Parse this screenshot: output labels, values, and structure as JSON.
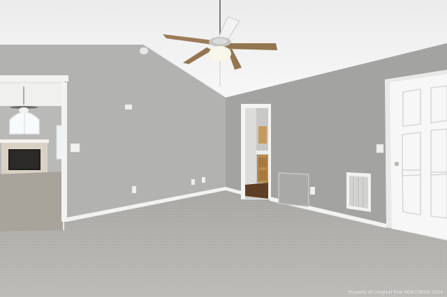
{
  "photo": {
    "credit": "Property of Longleaf Pine REALTORS® 2024",
    "colors": {
      "ceiling": "#f5f5f5",
      "wall_left": "#b3b4b2",
      "wall_right": "#a4a5a3",
      "carpet": "#b7b6b2",
      "trim": "#f4f4f2",
      "door": "#f7f7f7",
      "fan_blade": "#9a7b52"
    }
  }
}
